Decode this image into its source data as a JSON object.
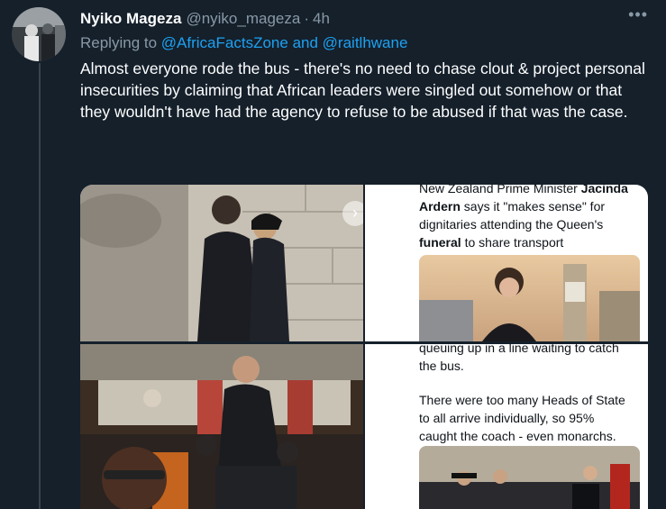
{
  "tweet": {
    "display_name": "Nyiko Mageza",
    "handle": "@nyiko_mageza",
    "separator": "·",
    "time": "4h",
    "more_label": "•••",
    "replying_prefix": "Replying to",
    "replying_mention_1": "@AfricaFactsZone",
    "replying_and": "and",
    "replying_mention_2": "@raitlhwane",
    "text": "Almost everyone rode the bus - there's no need to chase clout & project personal insecurities by claiming that African leaders were singled out somehow or that they wouldn't have had the agency to refuse to be abused if that was the case."
  },
  "media": {
    "article_top": {
      "cut_line": "New Zealand Prime Minister",
      "name_1": "Jacinda",
      "name_2": "Ardern",
      "line_2_rest": "says it \"makes sense\" for",
      "line_3": "dignitaries attending the Queen's",
      "bold_word": "funeral",
      "line_4_rest": "to share transport"
    },
    "article_bottom": {
      "cut_line": "queuing up in a line waiting to catch",
      "line_1": "the bus.",
      "para_2_line_1": "There were too many Heads of State",
      "para_2_line_2": "to all arrive individually, so 95%",
      "para_2_line_3": "caught the coach - even monarchs."
    },
    "nav_chevron": "›"
  },
  "colors": {
    "background": "#15202b",
    "secondary_text": "#8899a6",
    "link": "#1da1f2"
  }
}
